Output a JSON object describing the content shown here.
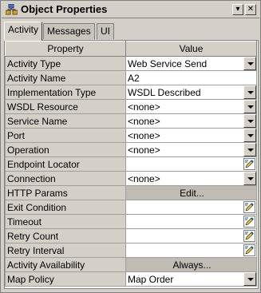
{
  "window": {
    "title": "Object Properties"
  },
  "tabs": [
    {
      "label": "Activity",
      "active": true
    },
    {
      "label": "Messages",
      "active": false
    },
    {
      "label": "UI",
      "active": false
    }
  ],
  "table": {
    "headers": [
      "Property",
      "Value"
    ],
    "rows": [
      {
        "property": "Activity Type",
        "value": "Web Service Send",
        "control": "dropdown"
      },
      {
        "property": "Activity Name",
        "value": "A2",
        "control": "text"
      },
      {
        "property": "Implementation Type",
        "value": "WSDL Described",
        "control": "dropdown"
      },
      {
        "property": "WSDL Resource",
        "value": "<none>",
        "control": "dropdown"
      },
      {
        "property": "Service Name",
        "value": "<none>",
        "control": "dropdown"
      },
      {
        "property": "Port",
        "value": "<none>",
        "control": "dropdown"
      },
      {
        "property": "Operation",
        "value": "<none>",
        "control": "dropdown"
      },
      {
        "property": "Endpoint Locator",
        "value": "",
        "control": "editor"
      },
      {
        "property": "Connection",
        "value": "<none>",
        "control": "dropdown"
      },
      {
        "property": "HTTP Params",
        "value": "Edit...",
        "control": "button"
      },
      {
        "property": "Exit Condition",
        "value": "",
        "control": "editor"
      },
      {
        "property": "Timeout",
        "value": "",
        "control": "editor"
      },
      {
        "property": "Retry Count",
        "value": "",
        "control": "editor"
      },
      {
        "property": "Retry Interval",
        "value": "",
        "control": "editor"
      },
      {
        "property": "Activity Availability",
        "value": "Always...",
        "control": "button"
      },
      {
        "property": "Map Policy",
        "value": "Map Order",
        "control": "dropdown"
      }
    ]
  },
  "icons": {
    "title": "object-properties-icon",
    "menu": "chevron-down-icon",
    "close": "close-icon",
    "dropdown": "chevron-down-icon",
    "editor": "pencil-editor-icon"
  },
  "colors": {
    "panel": "#d4d0c8",
    "cell": "#ffffff",
    "button_cell": "#c0bcb4"
  }
}
